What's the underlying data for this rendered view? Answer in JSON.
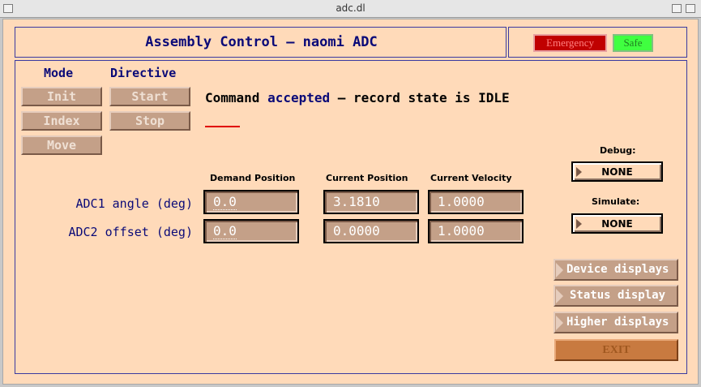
{
  "window": {
    "title": "adc.dl"
  },
  "header": {
    "title": "Assembly Control – naomi ADC",
    "emergency": "Emergency",
    "safe": "Safe"
  },
  "controls": {
    "mode_label": "Mode",
    "directive_label": "Directive",
    "init": "Init",
    "index": "Index",
    "move": "Move",
    "start": "Start",
    "stop": "Stop"
  },
  "message": {
    "prefix": "Command ",
    "accent": "accepted",
    "suffix": " – record state is IDLE"
  },
  "table": {
    "col_demand": "Demand Position",
    "col_current": "Current Position",
    "col_velocity": "Current Velocity",
    "rows": [
      {
        "label": "ADC1 angle (deg)",
        "demand": "0.0",
        "current": "3.1810",
        "velocity": "1.0000"
      },
      {
        "label": "ADC2 offset (deg)",
        "demand": "0.0",
        "current": "0.0000",
        "velocity": "1.0000"
      }
    ]
  },
  "debug": {
    "label": "Debug:",
    "value": "NONE"
  },
  "simulate": {
    "label": "Simulate:",
    "value": "NONE"
  },
  "related": {
    "device": "Device displays",
    "status": "Status display",
    "higher": "Higher displays"
  },
  "exit": "EXIT",
  "colors": {
    "background": "#ffdab9",
    "accent": "#0a0a78",
    "button": "#c4a088",
    "emergency": "#c00000",
    "safe": "#40ff40"
  }
}
